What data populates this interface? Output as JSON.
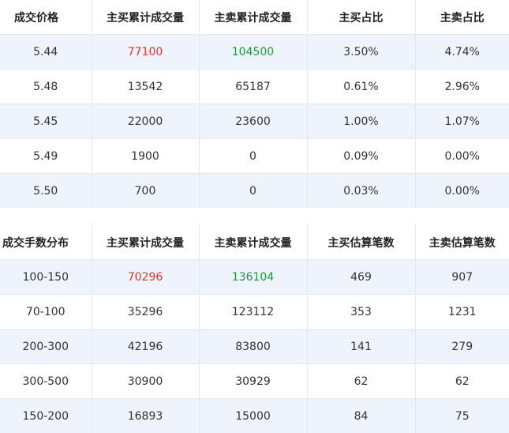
{
  "price_table": {
    "headers": [
      "成交价格",
      "主买累计成交量",
      "主卖累计成交量",
      "主买占比",
      "主卖占比"
    ],
    "rows": [
      [
        "5.44",
        "77100",
        "104500",
        "3.50%",
        "4.74%"
      ],
      [
        "5.48",
        "13542",
        "65187",
        "0.61%",
        "2.96%"
      ],
      [
        "5.45",
        "22000",
        "23600",
        "1.00%",
        "1.07%"
      ],
      [
        "5.49",
        "1900",
        "0",
        "0.09%",
        "0.00%"
      ],
      [
        "5.50",
        "700",
        "0",
        "0.03%",
        "0.00%"
      ]
    ]
  },
  "lot_table": {
    "headers": [
      "成交手数分布",
      "主买累计成交量",
      "主卖累计成交量",
      "主买估算笔数",
      "主卖估算笔数"
    ],
    "rows": [
      [
        "100-150",
        "70296",
        "136104",
        "469",
        "907"
      ],
      [
        "70-100",
        "35296",
        "123112",
        "353",
        "1231"
      ],
      [
        "200-300",
        "42196",
        "83800",
        "141",
        "279"
      ],
      [
        "300-500",
        "30900",
        "30929",
        "62",
        "62"
      ],
      [
        "150-200",
        "16893",
        "15000",
        "84",
        "75"
      ]
    ]
  },
  "colors": {
    "buy_highlight": "#e0352b",
    "sell_highlight": "#1a9a36",
    "row_shade": "#eef3fc"
  }
}
